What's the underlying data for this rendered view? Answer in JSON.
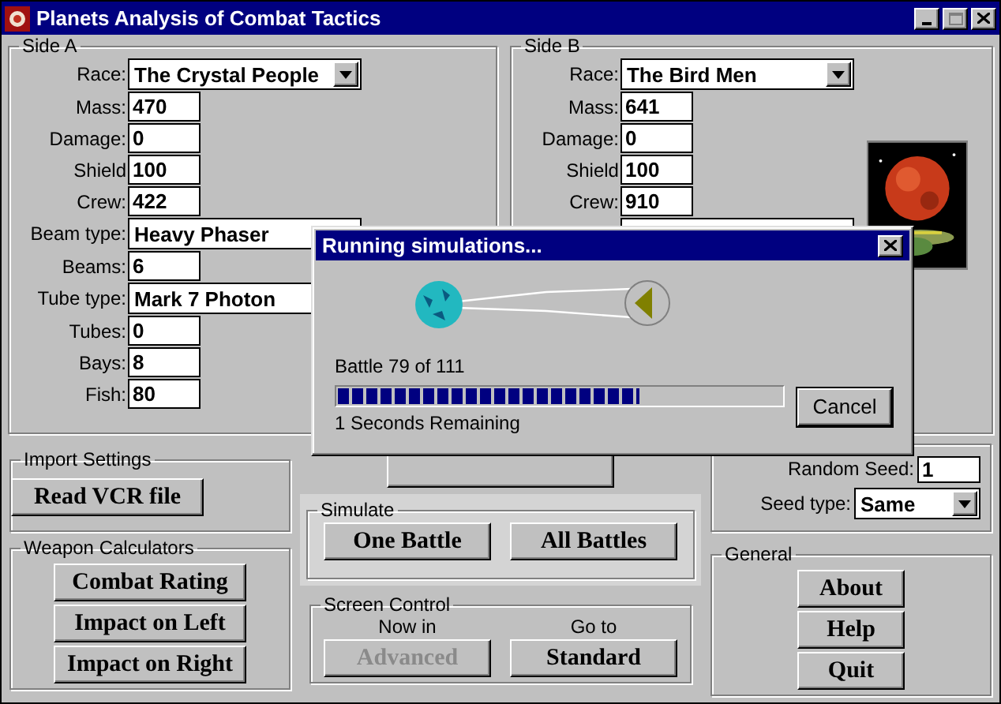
{
  "window": {
    "title": "Planets Analysis of Combat Tactics"
  },
  "side_a": {
    "title": "Side A",
    "fields": [
      {
        "label": "Race:",
        "value": "The Crystal People",
        "kind": "dropdown"
      },
      {
        "label": "Mass:",
        "value": "470",
        "kind": "text"
      },
      {
        "label": "Damage:",
        "value": "0",
        "kind": "text"
      },
      {
        "label": "Shield",
        "value": "100",
        "kind": "text"
      },
      {
        "label": "Crew:",
        "value": "422",
        "kind": "text"
      },
      {
        "label": "Beam type:",
        "value": "Heavy Phaser",
        "kind": "dropdown"
      },
      {
        "label": "Beams:",
        "value": "6",
        "kind": "text"
      },
      {
        "label": "Tube type:",
        "value": "Mark 7 Photon",
        "kind": "dropdown"
      },
      {
        "label": "Tubes:",
        "value": "0",
        "kind": "text"
      },
      {
        "label": "Bays:",
        "value": "8",
        "kind": "text"
      },
      {
        "label": "Fish:",
        "value": "80",
        "kind": "text"
      }
    ]
  },
  "side_b": {
    "title": "Side B",
    "fields": [
      {
        "label": "Race:",
        "value": "The Bird Men",
        "kind": "dropdown"
      },
      {
        "label": "Mass:",
        "value": "641",
        "kind": "text"
      },
      {
        "label": "Damage:",
        "value": "0",
        "kind": "text"
      },
      {
        "label": "Shield",
        "value": "100",
        "kind": "text"
      },
      {
        "label": "Crew:",
        "value": "910",
        "kind": "text"
      }
    ]
  },
  "import_settings": {
    "title": "Import Settings",
    "buttons": [
      "Read VCR file"
    ]
  },
  "weapon_calculators": {
    "title": "Weapon Calculators",
    "buttons": [
      "Combat Rating",
      "Impact on Left",
      "Impact on Right"
    ]
  },
  "simulate": {
    "title": "Simulate",
    "buttons": [
      "One Battle",
      "All Battles"
    ]
  },
  "screen_control": {
    "title": "Screen Control",
    "now_label": "Now in",
    "go_label": "Go to",
    "buttons": [
      {
        "label": "Advanced",
        "disabled": true
      },
      {
        "label": "Standard",
        "disabled": false
      }
    ]
  },
  "seed": {
    "random_seed_label": "Random Seed:",
    "random_seed": "1",
    "seed_type_label": "Seed type:",
    "seed_type": "Same"
  },
  "general": {
    "title": "General",
    "buttons": [
      "About",
      "Help",
      "Quit"
    ]
  },
  "dialog": {
    "title": "Running simulations...",
    "status": "Battle 79 of 111",
    "progress": {
      "level": 0.68
    },
    "remaining": "1 Seconds Remaining",
    "buttons": [
      "Cancel"
    ]
  }
}
